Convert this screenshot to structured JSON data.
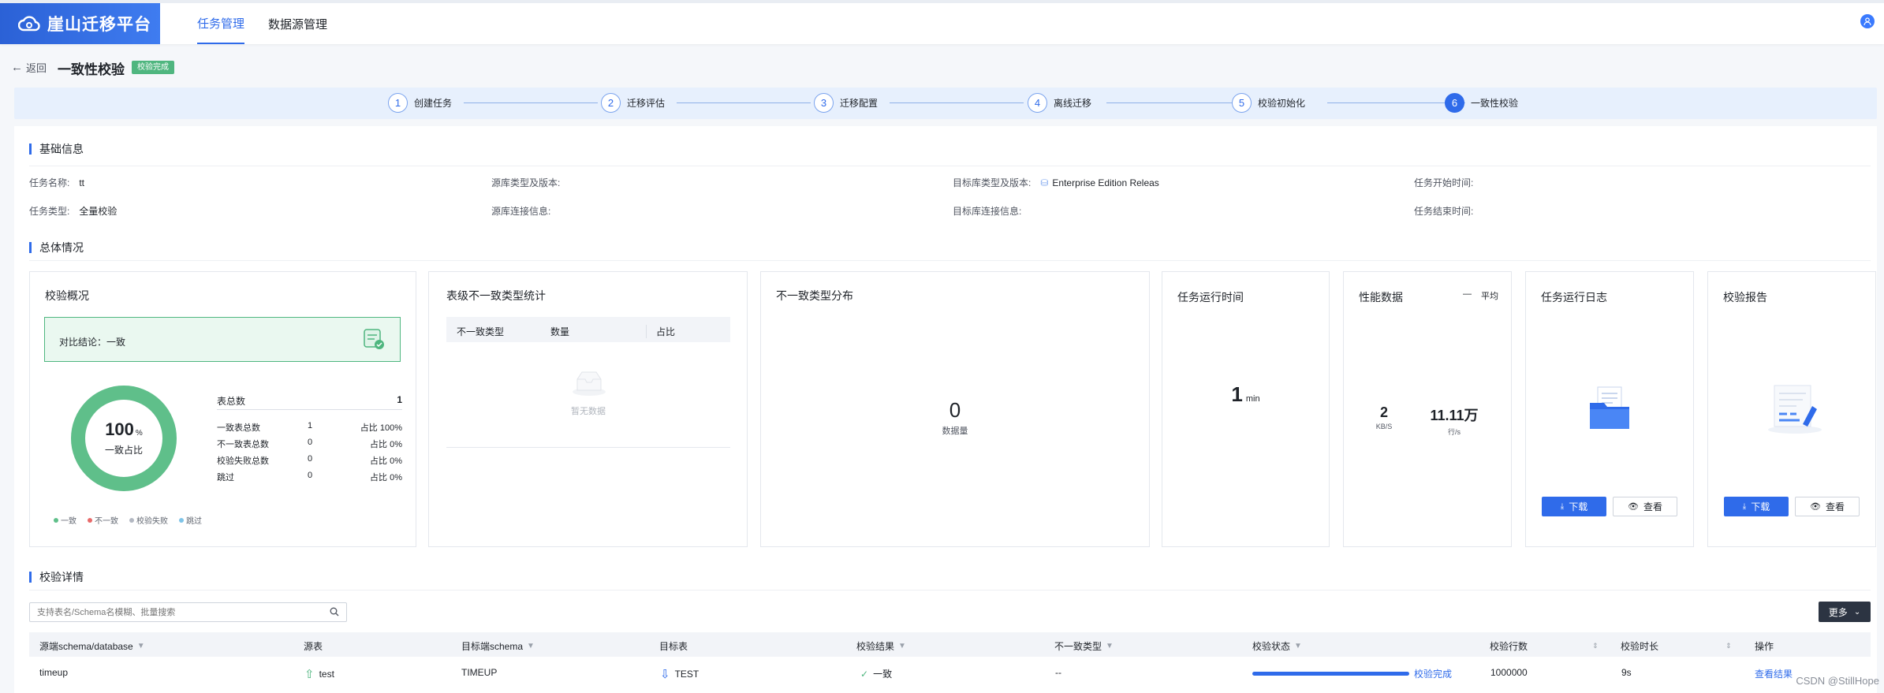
{
  "app": {
    "title": "崖山迁移平台"
  },
  "nav": [
    {
      "label": "任务管理"
    },
    {
      "label": "数据源管理"
    }
  ],
  "header": {
    "back": "返回",
    "title": "一致性校验",
    "badge": "校验完成"
  },
  "steps": [
    {
      "num": "1",
      "label": "创建任务"
    },
    {
      "num": "2",
      "label": "迁移评估"
    },
    {
      "num": "3",
      "label": "迁移配置"
    },
    {
      "num": "4",
      "label": "离线迁移"
    },
    {
      "num": "5",
      "label": "校验初始化"
    },
    {
      "num": "6",
      "label": "一致性校验"
    }
  ],
  "basic": {
    "title": "基础信息",
    "task_name_label": "任务名称:",
    "task_name": "tt",
    "task_type_label": "任务类型:",
    "task_type": "全量校验",
    "src_type_label": "源库类型及版本:",
    "src_type": "",
    "src_conn_label": "源库连接信息:",
    "src_conn": "",
    "tgt_type_label": "目标库类型及版本:",
    "tgt_type": "Enterprise Edition Releas",
    "tgt_conn_label": "目标库连接信息:",
    "tgt_conn": "",
    "start_label": "任务开始时间:",
    "start": "",
    "end_label": "任务结束时间:",
    "end": ""
  },
  "overview": {
    "title": "总体情况",
    "summary": {
      "title": "校验概况",
      "conclusion": "对比结论：一致",
      "percent": "100",
      "percent_unit": "%",
      "percent_label": "一致占比",
      "total_label": "表总数",
      "total": "1",
      "rows": [
        {
          "label": "一致表总数",
          "count": "1",
          "ratio": "占比 100%"
        },
        {
          "label": "不一致表总数",
          "count": "0",
          "ratio": "占比 0%"
        },
        {
          "label": "校验失败总数",
          "count": "0",
          "ratio": "占比 0%"
        },
        {
          "label": "跳过",
          "count": "0",
          "ratio": "占比 0%"
        }
      ],
      "legend": [
        {
          "label": "一致",
          "color": "#5fbf8a"
        },
        {
          "label": "不一致",
          "color": "#e86a6a"
        },
        {
          "label": "校验失败",
          "color": "#b3b8c2"
        },
        {
          "label": "跳过",
          "color": "#7fc4e8"
        }
      ],
      "consistent_fraction": 1.0
    },
    "table_stats": {
      "title": "表级不一致类型统计",
      "cols": [
        "不一致类型",
        "数量",
        "占比"
      ],
      "empty": "暂无数据"
    },
    "dist": {
      "title": "不一致类型分布",
      "value": "0",
      "label": "数据量"
    },
    "runtime": {
      "title": "任务运行时间",
      "value": "1",
      "unit": "min"
    },
    "perf": {
      "title": "性能数据",
      "toggle": "平均",
      "v1": "2",
      "u1": "KB/S",
      "v2": "11.11万",
      "u2": "行/s"
    },
    "log": {
      "title": "任务运行日志",
      "download": "下载",
      "view": "查看"
    },
    "report": {
      "title": "校验报告",
      "download": "下载",
      "view": "查看"
    }
  },
  "detail": {
    "title": "校验详情",
    "search_placeholder": "支持表名/Schema名模糊、批量搜索",
    "more": "更多",
    "columns": [
      "源端schema/database",
      "源表",
      "目标端schema",
      "目标表",
      "校验结果",
      "不一致类型",
      "校验状态",
      "校验行数",
      "校验时长",
      "操作"
    ],
    "rows": [
      {
        "src_schema": "timeup",
        "src_table": "test",
        "tgt_schema": "TIMEUP",
        "tgt_table": "TEST",
        "result": "一致",
        "diff_type": "--",
        "status": "校验完成",
        "progress": 1.0,
        "rows": "1000000",
        "duration": "9s",
        "action": "查看结果"
      }
    ]
  },
  "watermark": "CSDN @StillHope",
  "colors": {
    "primary": "#2f6bea",
    "success": "#4fb67f"
  }
}
